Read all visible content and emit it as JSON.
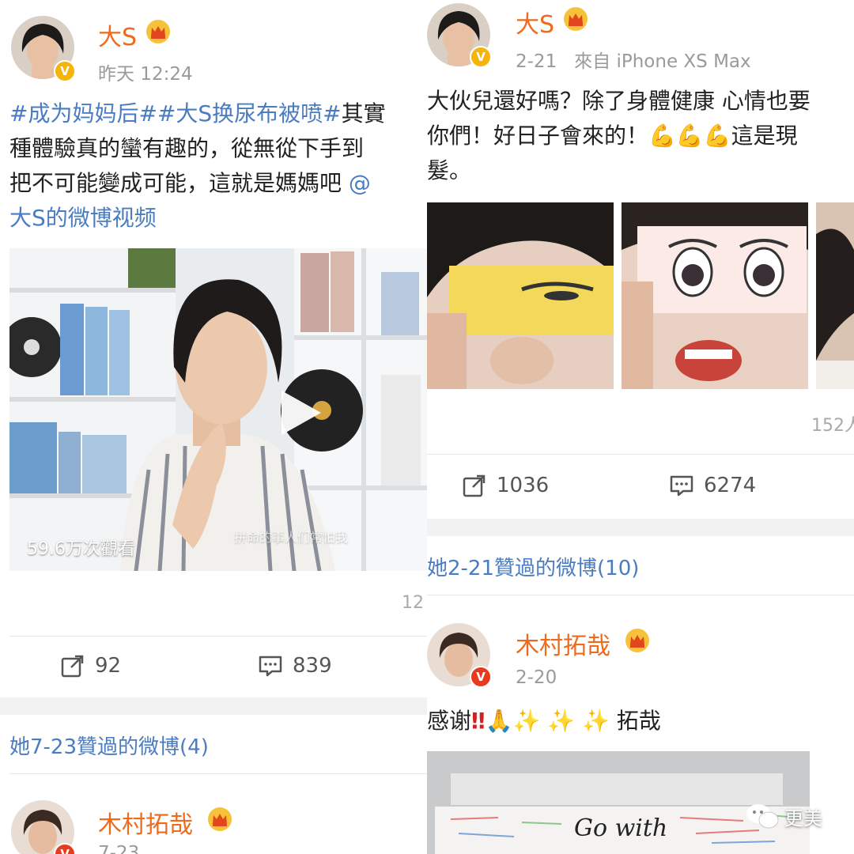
{
  "left": {
    "post1": {
      "username": "大S",
      "time": "昨天 12:24",
      "tag1": "#成为妈妈后#",
      "tag2": "#大S换尿布被喷#",
      "line1_text": "其實",
      "line2": "種體驗真的蠻有趣的，從無從下手到",
      "line3": "把不可能變成可能，這就是媽媽吧",
      "line3_link": "@",
      "line4_link": "大S的微博视频",
      "video_views": "59.6万次觀看",
      "video_caption": "拼命的事人们常怕我",
      "count_clip": "12",
      "repost_count": "92",
      "comment_count": "839"
    },
    "liked_header": "她7-23贊過的微博(4)",
    "post2": {
      "username": "木村拓哉",
      "time": "7-23"
    }
  },
  "right": {
    "post1": {
      "username": "大S",
      "time": "2-21",
      "source": "來自 iPhone XS Max",
      "line1": "大伙兒還好嗎？除了身體健康 心情也要",
      "line2_a": "你們！好日子會來的！",
      "line2_b": "這是現",
      "line3": "髮。",
      "count_clip": "152人",
      "repost_count": "1036",
      "comment_count": "6274"
    },
    "liked_header": "她2-21贊過的微博(10)",
    "post2": {
      "username": "木村拓哉",
      "time": "2-20",
      "text_a": "感谢",
      "text_b": "拓哉",
      "photo_text": "Go with"
    }
  },
  "watermark": "更美",
  "colors": {
    "username": "#ec6b1f",
    "link": "#4a7cc2",
    "meta": "#9a9a9a",
    "verified_gold": "#f5b40a",
    "verified_red": "#e83b1d"
  },
  "icons": [
    "crown-icon",
    "verified-icon",
    "play-icon",
    "repost-icon",
    "comment-icon",
    "muscle-emoji",
    "double-exclamation-emoji",
    "pray-emoji",
    "sparkles-emoji",
    "wechat-icon"
  ]
}
